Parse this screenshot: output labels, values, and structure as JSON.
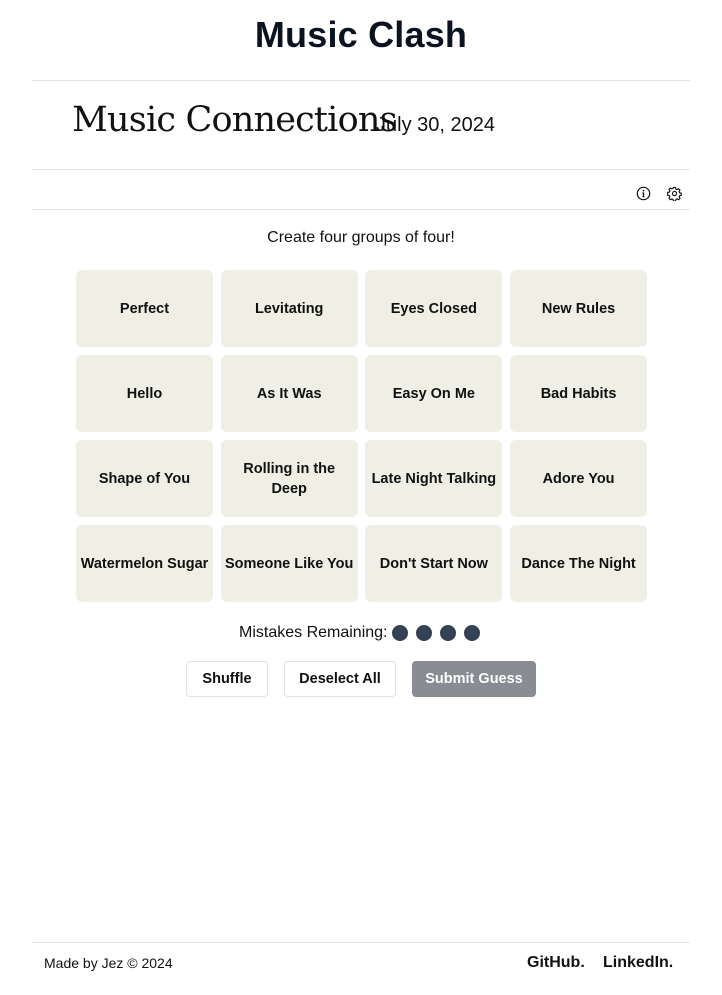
{
  "header": {
    "site_title": "Music Clash"
  },
  "game": {
    "title": "Music Connections",
    "date": "July 30, 2024",
    "instructions": "Create four groups of four!",
    "tiles": [
      "Perfect",
      "Levitating",
      "Eyes Closed",
      "New Rules",
      "Hello",
      "As It Was",
      "Easy On Me",
      "Bad Habits",
      "Shape of You",
      "Rolling in the Deep",
      "Late Night Talking",
      "Adore You",
      "Watermelon Sugar",
      "Someone Like You",
      "Don't Start Now",
      "Dance The Night"
    ],
    "mistakes_label": "Mistakes Remaining:",
    "mistakes_remaining": 4,
    "dot_color": "#334155",
    "tile_color": "#efefe6"
  },
  "toolbar": {
    "info_icon": "info-icon",
    "settings_icon": "gear-icon"
  },
  "actions": {
    "shuffle_label": "Shuffle",
    "deselect_label": "Deselect All",
    "submit_label": "Submit Guess",
    "submit_color": "#8a8c93"
  },
  "footer": {
    "credit": "Made by Jez © 2024",
    "github_label": "GitHub.",
    "linkedin_label": "LinkedIn."
  }
}
